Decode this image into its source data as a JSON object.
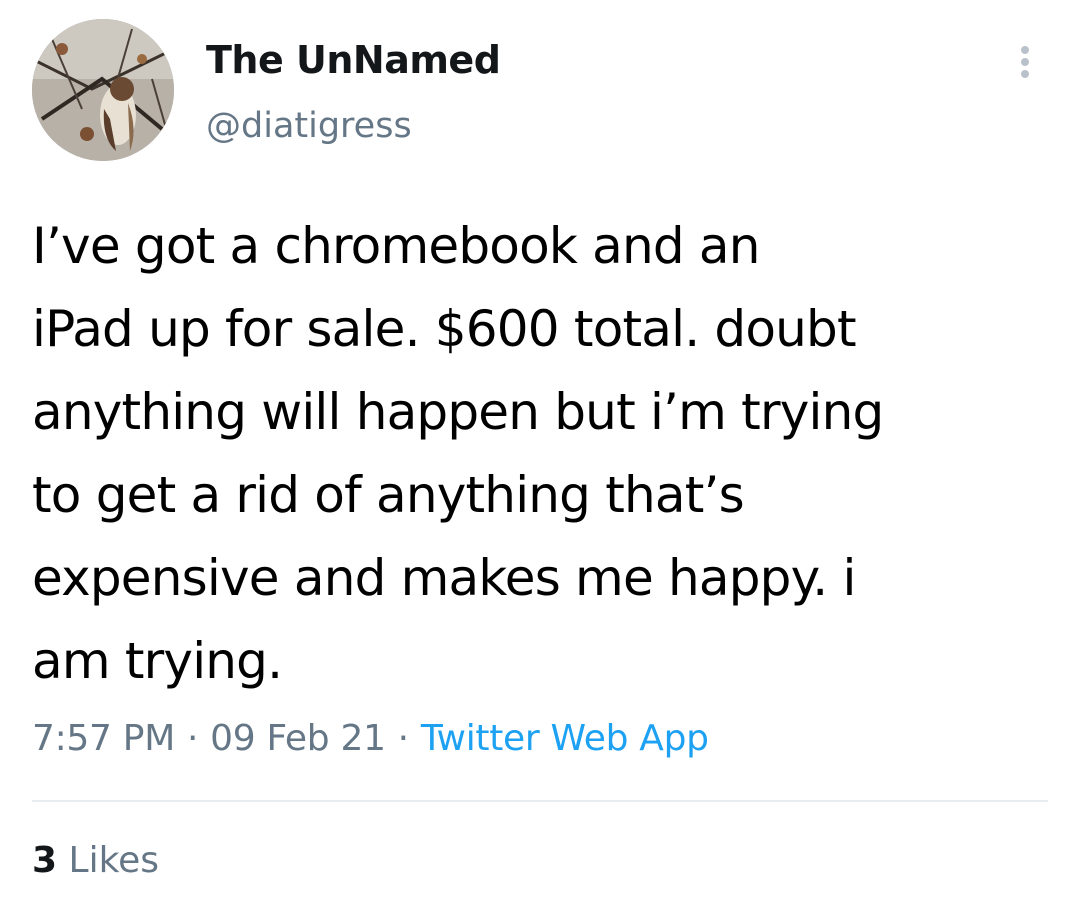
{
  "user": {
    "display_name": "The UnNamed",
    "handle": "@diatigress",
    "avatar_icon": "hawk-photo-avatar"
  },
  "tweet": {
    "text": "I’ve got a chromebook and an\niPad up for sale. $600 total. doubt\nanything will happen but i’m trying\nto get a rid of anything that’s\nexpensive and makes me happy. i\nam trying.",
    "time": "7:57 PM",
    "date": "09 Feb 21",
    "separator": "·",
    "source": "Twitter Web App"
  },
  "stats": {
    "likes_count": "3",
    "likes_label": "Likes"
  },
  "icons": {
    "more": "more-vertical-icon"
  },
  "colors": {
    "text": "#000000",
    "secondary": "#657786",
    "link": "#1da1f2",
    "divider": "#e6ecf0"
  }
}
